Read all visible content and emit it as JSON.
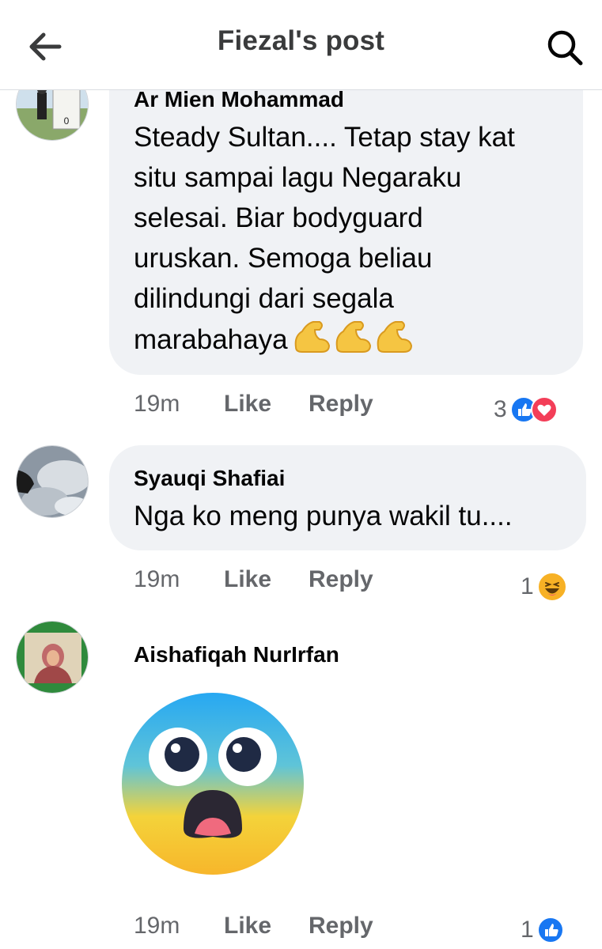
{
  "header": {
    "title": "Fiezal's post"
  },
  "comments": [
    {
      "author": "Ar Mien Mohammad",
      "text": "Steady Sultan.... Tetap stay kat situ sampai lagu Negaraku selesai. Biar bodyguard uruskan. Semoga beliau dilindungi dari segala marabahaya",
      "text_lines": [
        "Steady Sultan.... Tetap stay kat",
        "situ sampai lagu Negaraku",
        "selesai. Biar bodyguard",
        "uruskan. Semoga beliau",
        "dilindungi dari segala",
        "marabahaya"
      ],
      "emoji": "flexed-biceps x3",
      "time": "19m",
      "like_label": "Like",
      "reply_label": "Reply",
      "reaction_count": "3",
      "reactions": [
        "like",
        "love"
      ]
    },
    {
      "author": "Syauqi Shafiai",
      "text": "Nga ko meng punya wakil tu....",
      "time": "19m",
      "like_label": "Like",
      "reply_label": "Reply",
      "reaction_count": "1",
      "reactions": [
        "haha"
      ]
    },
    {
      "author": "Aishafiqah NurIrfan",
      "sticker": "fearful-face",
      "time": "19m",
      "like_label": "Like",
      "reply_label": "Reply",
      "reaction_count": "1",
      "reactions": [
        "like"
      ]
    }
  ],
  "colors": {
    "like": "#1877f2",
    "love": "#f33e58",
    "bubble": "#f0f2f5",
    "meta": "#65676b"
  }
}
